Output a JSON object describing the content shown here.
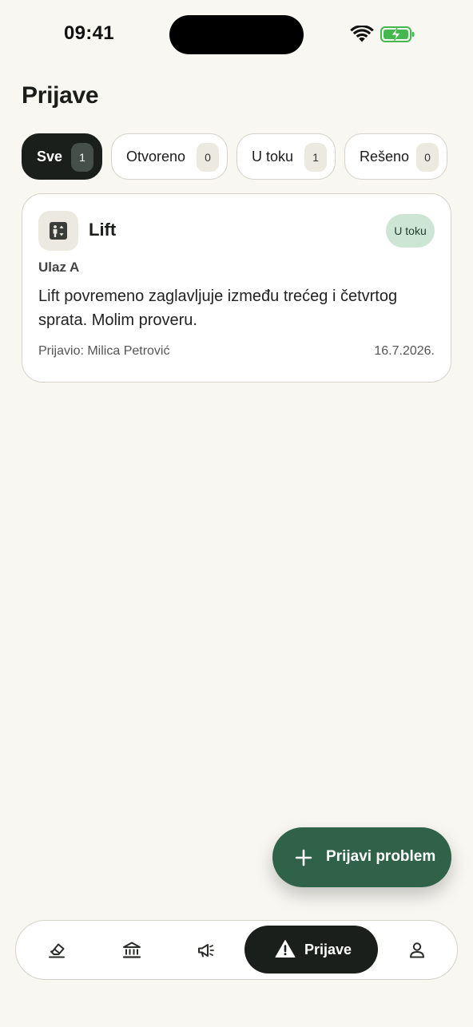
{
  "status_bar": {
    "time": "09:41"
  },
  "page": {
    "title": "Prijave"
  },
  "filters": [
    {
      "label": "Sve",
      "count": "1",
      "active": true
    },
    {
      "label": "Otvoreno",
      "count": "0",
      "active": false
    },
    {
      "label": "U toku",
      "count": "1",
      "active": false
    },
    {
      "label": "Rešeno",
      "count": "0",
      "active": false
    }
  ],
  "reports": [
    {
      "icon": "elevator-icon",
      "title": "Lift",
      "status": "U toku",
      "location": "Ulaz A",
      "description": "Lift povremeno zaglavljuje između trećeg i četvrtog sprata. Molim proveru.",
      "reporter": "Prijavio: Milica Petrović",
      "date": "16.7.2026."
    }
  ],
  "fab": {
    "label": "Prijavi problem"
  },
  "nav": {
    "items": [
      {
        "icon": "eraser-icon"
      },
      {
        "icon": "bank-icon"
      },
      {
        "icon": "megaphone-icon"
      },
      {
        "icon": "alert-triangle-icon",
        "label": "Prijave",
        "active": true
      },
      {
        "icon": "person-icon"
      }
    ]
  },
  "colors": {
    "background": "#f8f7f2",
    "accent": "#2f6248",
    "dark": "#1b1f1c",
    "status_in_progress": "#cde5d5"
  }
}
